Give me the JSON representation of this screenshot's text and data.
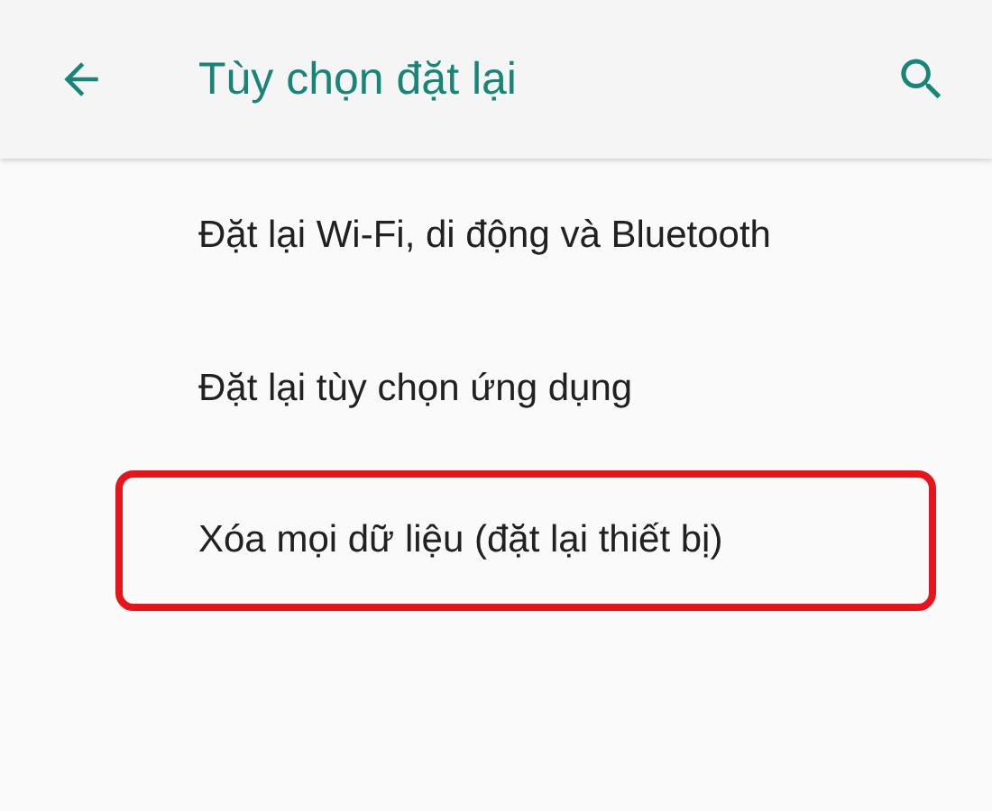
{
  "app_bar": {
    "title": "Tùy chọn đặt lại"
  },
  "items": [
    {
      "label": "Đặt lại Wi-Fi, di động và Bluetooth",
      "highlighted": false
    },
    {
      "label": "Đặt lại tùy chọn ứng dụng",
      "highlighted": false
    },
    {
      "label": "Xóa mọi dữ liệu (đặt lại thiết bị)",
      "highlighted": true
    }
  ]
}
